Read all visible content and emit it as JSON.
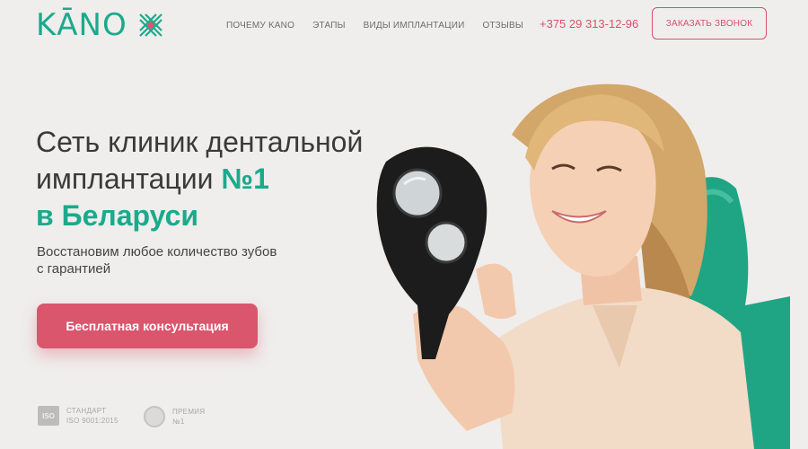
{
  "header": {
    "logo_text": "KĀNO",
    "nav": [
      "ПОЧЕМУ KANO",
      "ЭТАПЫ",
      "ВИДЫ ИМПЛАНТАЦИИ",
      "ОТЗЫВЫ"
    ],
    "phone": "+375 29 313-12-96",
    "call_button": "ЗАКАЗАТЬ ЗВОНОК"
  },
  "hero": {
    "title_line1": "Сеть клиник дентальной",
    "title_line2a": "имплантации ",
    "title_line2b": "№1",
    "title_line3": "в Беларуси",
    "subtitle_line1": "Восстановим любое количество зубов",
    "subtitle_line2": "с гарантией",
    "cta": "Бесплатная консультация"
  },
  "badges": [
    {
      "icon_text": "ISO",
      "line1": "СТАНДАРТ",
      "line2": "ISO 9001:2015"
    },
    {
      "line1": "ПРЕМИЯ",
      "line2": "№1"
    }
  ],
  "colors": {
    "brand_green": "#1aaa8c",
    "accent_pink": "#d9566d",
    "background": "#efeeec"
  }
}
